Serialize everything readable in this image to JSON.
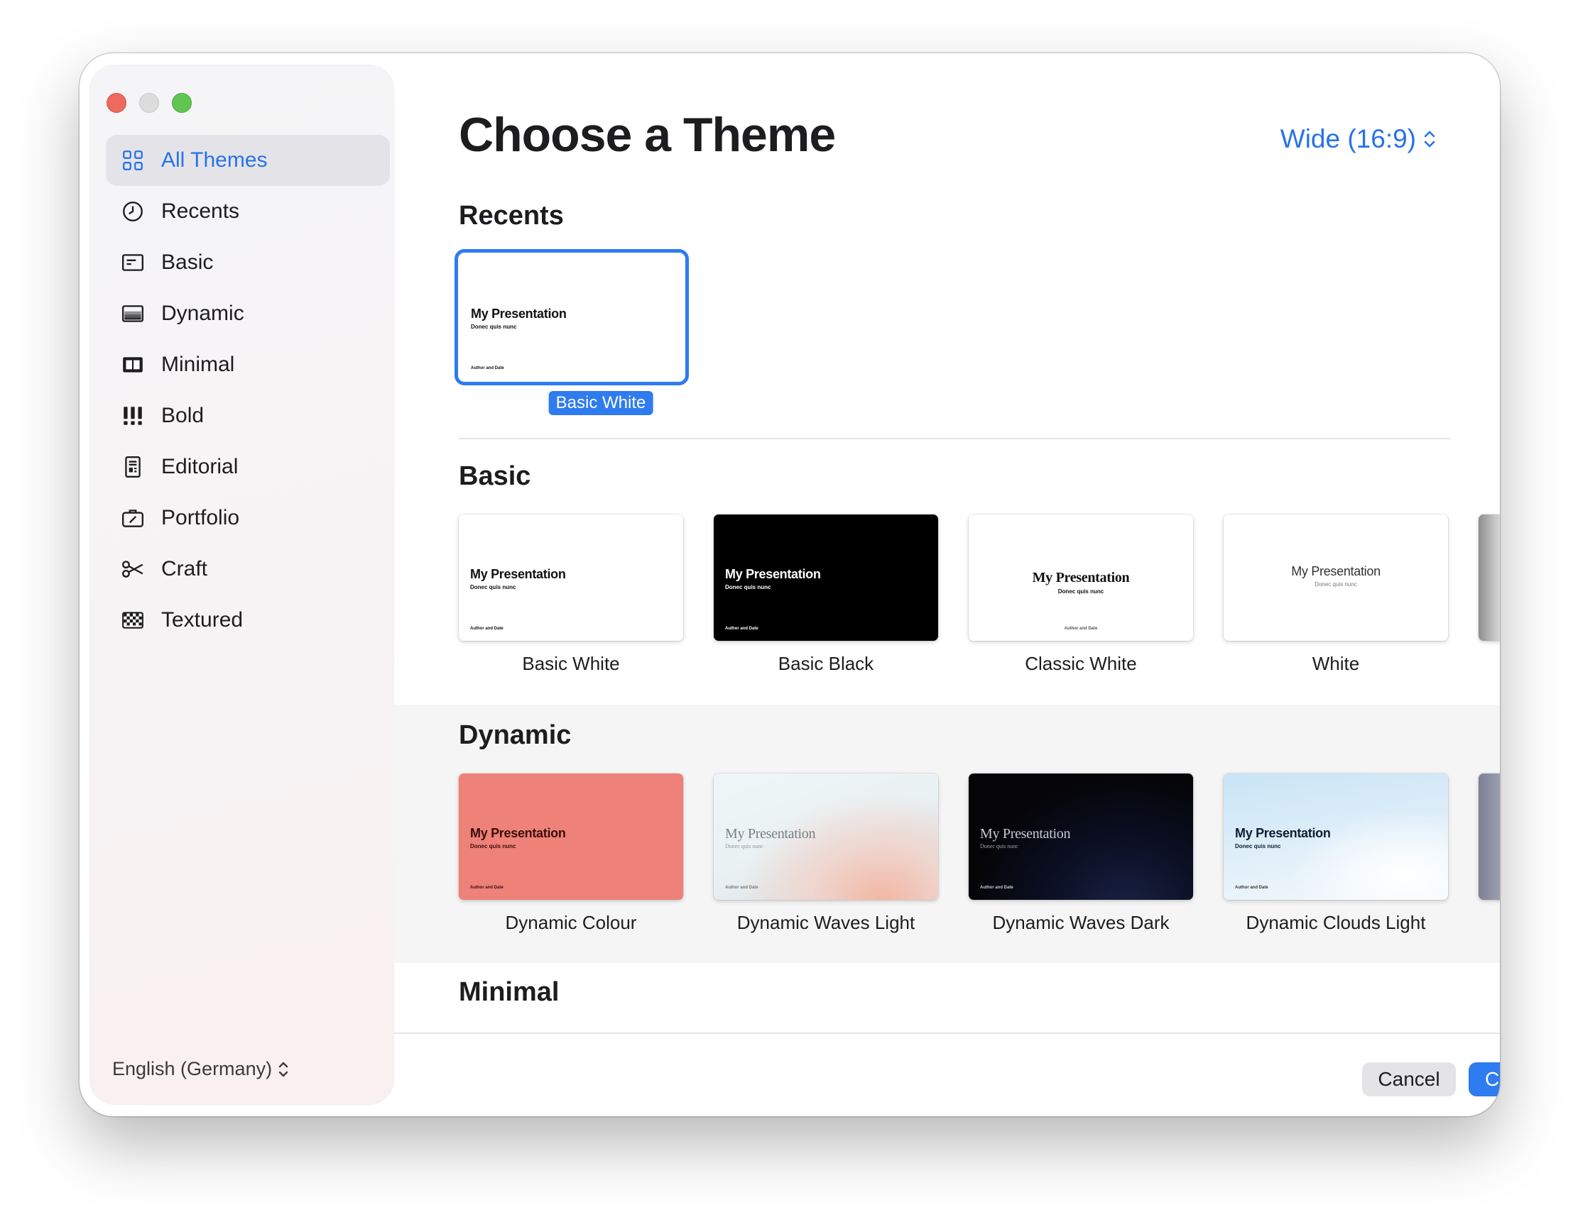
{
  "sidebar": {
    "items": [
      {
        "label": "All Themes",
        "icon": "grid-icon"
      },
      {
        "label": "Recents",
        "icon": "clock-icon"
      },
      {
        "label": "Basic",
        "icon": "basic-slide-icon"
      },
      {
        "label": "Dynamic",
        "icon": "dynamic-slide-icon"
      },
      {
        "label": "Minimal",
        "icon": "minimal-slide-icon"
      },
      {
        "label": "Bold",
        "icon": "exclamation-icon"
      },
      {
        "label": "Editorial",
        "icon": "editorial-icon"
      },
      {
        "label": "Portfolio",
        "icon": "portfolio-icon"
      },
      {
        "label": "Craft",
        "icon": "scissors-icon"
      },
      {
        "label": "Textured",
        "icon": "checker-icon"
      }
    ],
    "language": "English (Germany)"
  },
  "header": {
    "title": "Choose a Theme",
    "slide_size": "Wide (16:9)"
  },
  "sections": {
    "recents": "Recents",
    "basic": "Basic",
    "dynamic": "Dynamic",
    "minimal": "Minimal"
  },
  "thumb_text": {
    "title": "My Presentation",
    "subtitle": "Donec quis nunc",
    "author": "Author and Date"
  },
  "recents": {
    "selected": "Basic White"
  },
  "basic_themes": [
    "Basic White",
    "Basic Black",
    "Classic White",
    "White"
  ],
  "dynamic_themes": [
    "Dynamic Colour",
    "Dynamic Waves Light",
    "Dynamic Waves Dark",
    "Dynamic Clouds Light"
  ],
  "footer": {
    "cancel": "Cancel",
    "create": "Create"
  },
  "colors": {
    "accent": "#2f7bf0",
    "dynamic_colour": "#ee8178"
  }
}
